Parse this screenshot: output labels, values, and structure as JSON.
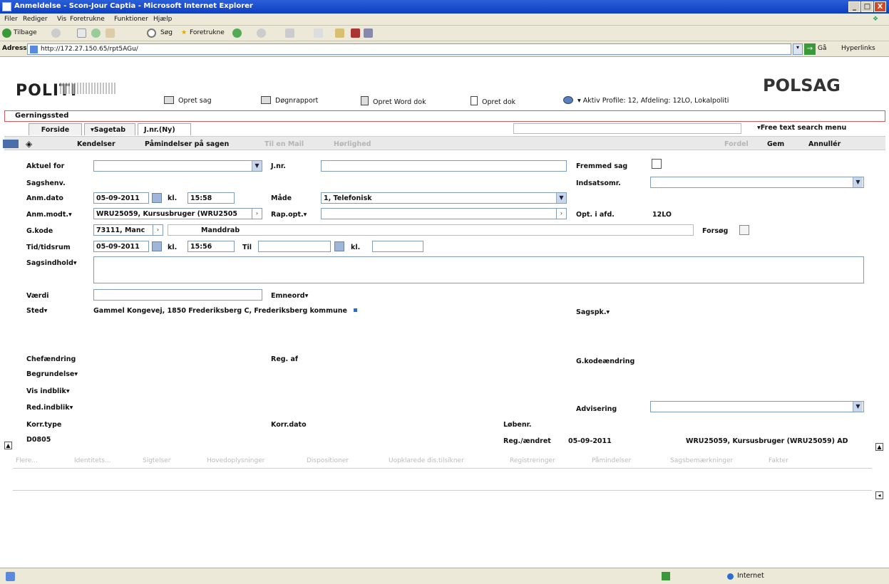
{
  "window": {
    "title": "Anmeldelse - Scon-Jour Captia - Microsoft Internet Explorer",
    "min": "_",
    "max": "□",
    "close": "X"
  },
  "menu": [
    "Filer",
    "Rediger",
    "Vis",
    "Foretrukne",
    "Funktioner",
    "Hjælp"
  ],
  "toolbar": {
    "back": "Tilbage",
    "search": "Søg",
    "favorites": "Foretrukne"
  },
  "address": {
    "label": "Adresse",
    "url": "http://172.27.150.65/rpt5AGu/",
    "go": "Gå",
    "links": "Hyperlinks"
  },
  "header": {
    "logo": "POLITI",
    "app": "POLSAG",
    "actions": [
      "Opret sag",
      "Døgnrapport",
      "Opret Word dok",
      "Opret dok"
    ],
    "profile": "Aktiv Profile: 12, Afdeling: 12LO, Lokalpoliti"
  },
  "gerningssted": "Gerningssted",
  "tabs": [
    "Forside",
    "Sagetab",
    "J.nr.(Ny)"
  ],
  "free_text_menu": "Free text search menu",
  "subtoolbar": {
    "items": [
      "Kendelser",
      "Påmindelser på sagen"
    ],
    "dim_items": [
      "Til en Mail",
      "Hørlighed"
    ],
    "fordele": "Fordel",
    "save": "Gem",
    "cancel": "Annullér"
  },
  "form": {
    "aktuel_for": "Aktuel for",
    "jnr": "J.nr.",
    "fremmed_sag": "Fremmed sag",
    "sagshenv": "Sagshenv.",
    "indsatsomr": "Indsatsomr.",
    "anm_dato": "Anm.dato",
    "anm_dato_val": "05-09-2011",
    "kl": "kl.",
    "anm_kl_val": "15:58",
    "maade": "Måde",
    "maade_val": "1, Telefonisk",
    "anm_modt": "Anm.modt.▾",
    "anm_modt_val": "WRU25059, Kursusbruger (WRU2505",
    "rap_opt": "Rap.opt.▾",
    "opt_i_afd": "Opt. i afd.",
    "opt_i_afd_val": "12LO",
    "g_kode": "G.kode",
    "g_kode_val": "73111, Manc",
    "g_kode_text": "Manddrab",
    "forsoeg": "Forsøg",
    "tid": "Tid/tidsrum",
    "tid_val": "05-09-2011",
    "tid_kl_val": "15:56",
    "til": "Til",
    "sagsindhold": "Sagsindhold▾",
    "vaerdi": "Værdi",
    "emneord": "Emneord▾",
    "sted": "Sted▾",
    "sted_val": "Gammel Kongevej, 1850  Frederiksberg C,  Frederiksberg kommune",
    "sagspk": "Sagspk.▾",
    "chefaendring": "Chefændring",
    "reg_af": "Reg. af",
    "g_kodeaendring": "G.kodeændring",
    "begrundelse": "Begrundelse▾",
    "vis_indblik": "Vis indblik▾",
    "red_indblik": "Red.indblik▾",
    "advisering": "Advisering",
    "korr_type": "Korr.type",
    "korr_dato": "Korr.dato",
    "loebenr": "Løbenr.",
    "d0805": "D0805",
    "reg_aendret": "Reg./ændret",
    "reg_aendret_val": "05-09-2011",
    "reg_user": "WRU25059, Kursusbruger (WRU25059) AD"
  },
  "bottom_tabs": [
    "Flere...",
    "Identitets...",
    "Sigtelser",
    "Hovedoplysninger",
    "Dispositioner",
    "Uopklarede dis.tilsikner",
    "Registreringer",
    "Påmindelser",
    "Sagsbemærkninger",
    "Fakter"
  ],
  "status": {
    "zone": "Internet"
  }
}
